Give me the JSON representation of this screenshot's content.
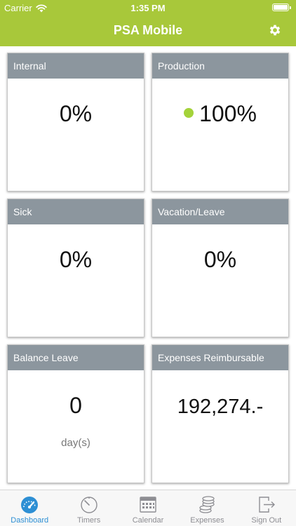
{
  "status_bar": {
    "carrier": "Carrier",
    "time": "1:35 PM"
  },
  "nav": {
    "title": "PSA Mobile",
    "settings_icon": "gear-icon"
  },
  "colors": {
    "accent": "#a8c83a",
    "card_header": "#8c969e",
    "status_dot": "#a4d33a",
    "tab_active": "#2d8fd4"
  },
  "cards": [
    {
      "title": "Internal",
      "value": "0%"
    },
    {
      "title": "Production",
      "value": "100%",
      "status_dot": true
    },
    {
      "title": "Sick",
      "value": "0%"
    },
    {
      "title": "Vacation/Leave",
      "value": "0%"
    },
    {
      "title": "Balance Leave",
      "value": "0",
      "unit": "day(s)"
    },
    {
      "title": "Expenses Reimbursable",
      "value": "192,274.-"
    }
  ],
  "tabs": [
    {
      "label": "Dashboard",
      "icon": "speedometer-icon",
      "active": true
    },
    {
      "label": "Timers",
      "icon": "timer-icon",
      "active": false
    },
    {
      "label": "Calendar",
      "icon": "calendar-icon",
      "active": false
    },
    {
      "label": "Expenses",
      "icon": "coins-icon",
      "active": false
    },
    {
      "label": "Sign Out",
      "icon": "sign-out-icon",
      "active": false
    }
  ]
}
